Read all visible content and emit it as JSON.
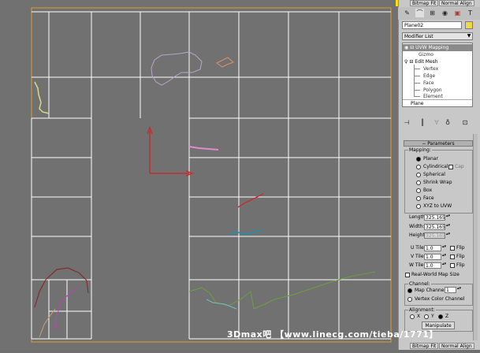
{
  "colors": {
    "viewport_bg": "#717171",
    "grid_line": "#ffffff",
    "gizmo_orange": "#e0a020",
    "selection_yellow": "#ffe000",
    "panel_bg": "#c8c8c8"
  },
  "top_buttons": {
    "bitmap_fit": "Bitmap Fit",
    "normal_align": "Normal Align"
  },
  "bottom_buttons": {
    "bitmap_fit": "Bitmap Fit",
    "normal_align": "Normal Align"
  },
  "command_tabs": [
    "create-icon",
    "modify-icon",
    "hierarchy-icon",
    "motion-icon",
    "display-icon",
    "utilities-icon"
  ],
  "object_name": "Plane02",
  "modifier_list_label": "Modifier List",
  "stack": {
    "items": [
      {
        "label": "UVW Mapping",
        "selected": true
      },
      {
        "label": "Gizmo",
        "sub": true
      },
      {
        "label": "Edit Mesh"
      },
      {
        "label": "Vertex",
        "sub": true
      },
      {
        "label": "Edge",
        "sub": true
      },
      {
        "label": "Face",
        "sub": true
      },
      {
        "label": "Polygon",
        "sub": true
      },
      {
        "label": "Element",
        "sub": true
      },
      {
        "label": "Plane"
      }
    ]
  },
  "parameters": {
    "title": "Parameters",
    "mapping_group": "Mapping:",
    "mapping_options": [
      "Planar",
      "Cylindrical",
      "Spherical",
      "Shrink Wrap",
      "Box",
      "Face",
      "XYZ to UVW"
    ],
    "selected_mapping": "Planar",
    "cap_label": "Cap",
    "length_label": "Length:",
    "length_value": "325.165",
    "width_label": "Width:",
    "width_value": "325.165",
    "height_label": "Height:",
    "height_value": "325.165",
    "u_tile_label": "U Tile",
    "u_tile_value": "1.0",
    "v_tile_label": "V Tile",
    "v_tile_value": "1.0",
    "w_tile_label": "W Tile",
    "w_tile_value": "1.0",
    "flip_label": "Flip",
    "real_world": "Real-World Map Size",
    "channel_group": "Channel:",
    "map_channel_label": "Map Channel:",
    "map_channel_value": "1",
    "vertex_color_channel": "Vertex Color Channel",
    "alignment_group": "Alignment:",
    "align_axes": [
      "X",
      "Y",
      "Z"
    ],
    "selected_axis": "Z",
    "manipulate": "Manipulate"
  },
  "watermark": "3Dmax吧 【www.linecg.com/tieba/1771】"
}
